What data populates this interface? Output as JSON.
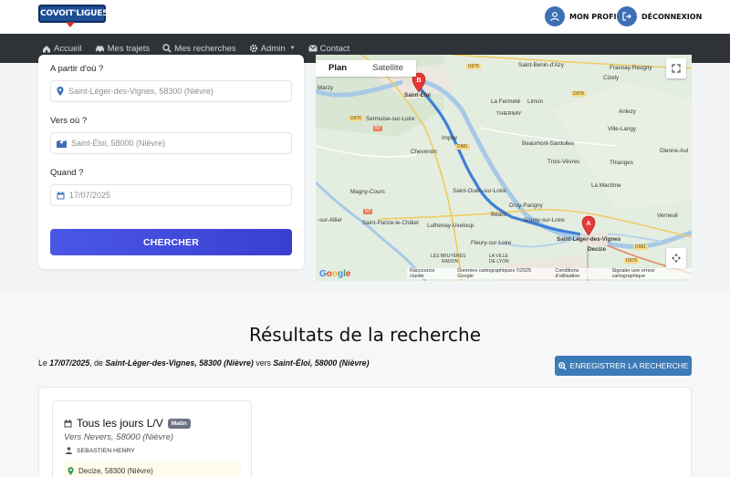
{
  "brand": {
    "logo_text": "COVOIT'LIGUE58"
  },
  "topbar": {
    "profile_label": "MON PROFIL",
    "logout_label": "DÉCONNEXION"
  },
  "nav": {
    "items": [
      {
        "label": "Accueil",
        "icon": "home-icon"
      },
      {
        "label": "Mes trajets",
        "icon": "car-icon"
      },
      {
        "label": "Mes recherches",
        "icon": "search-icon"
      },
      {
        "label": "Admin",
        "icon": "gear-icon"
      },
      {
        "label": "Contact",
        "icon": "envelope-icon"
      }
    ]
  },
  "search": {
    "from_label": "A partir d'où ?",
    "from_value": "Saint-Léger-des-Vignes, 58300 (Nièvre)",
    "to_label": "Vers où ?",
    "to_value": "Saint-Éloi, 58000 (Nièvre)",
    "when_label": "Quand ?",
    "when_value": "17/07/2025",
    "button_label": "CHERCHER"
  },
  "map": {
    "tab_plan": "Plan",
    "tab_satellite": "Satellite",
    "marker_a": "A",
    "marker_b": "B",
    "google": "Google",
    "footer": [
      "Raccourcis clavier",
      "Données cartographiques ©2025 Google",
      "Conditions d'utilisation",
      "Signaler une erreur cartographique"
    ],
    "places": [
      "Marzy",
      "Saint-Éloi",
      "Sermoise-sur-Loire",
      "Imphy",
      "Chevenon",
      "La Fermeté",
      "Limon",
      "THIERNAY",
      "Beaumont-Sardolles",
      "Trois-Vèvres",
      "Saint-Ouen-sur-Loire",
      "Magny-Cours",
      "Druy-Parigny",
      "Béard",
      "Sougy-sur-Loire",
      "Saint-Parize-le-Châtel",
      "Luthenay-Uxeloup",
      "Fleury-sur-Loire",
      "Saint-Léger-des-Vignes",
      "Decize",
      "Saint-Benin-d'Azy",
      "Frasnay-Reugny",
      "Cizely",
      "Anlezy",
      "Ville-Langy",
      "Dienne-Aul",
      "Thianges",
      "La Machine",
      "Verneuil",
      "LES BRUYÈRES",
      "RADON",
      "LA VILLE DE LYON",
      "-sur-Allier"
    ],
    "roads": [
      "D978",
      "D978",
      "D976",
      "N7",
      "D981",
      "N7",
      "D981",
      "D979"
    ]
  },
  "results": {
    "title": "Résultats de la recherche",
    "info_prefix": "Le ",
    "info_date": "17/07/2025",
    "info_mid1": ", de ",
    "info_from": "Saint-Léger-des-Vignes, 58300 (Nièvre)",
    "info_mid2": " vers ",
    "info_to": "Saint-Éloi, 58000 (Nièvre)",
    "save_button": "ENREGISTRER LA RECHERCHE",
    "trips": [
      {
        "title": "Tous les jours L/V",
        "badge": "Matin",
        "destination": "Vers Nevers, 58000 (Nièvre)",
        "driver": "SEBASTIEN HENRY",
        "step": "Decize, 58300 (Nièvre)"
      }
    ]
  },
  "colors": {
    "brand_blue": "#3d6fb6",
    "nav_bg": "#2f3237",
    "button_purple": "#4a57e6",
    "route_blue": "#4a8ed8",
    "marker_red": "#e53935"
  }
}
